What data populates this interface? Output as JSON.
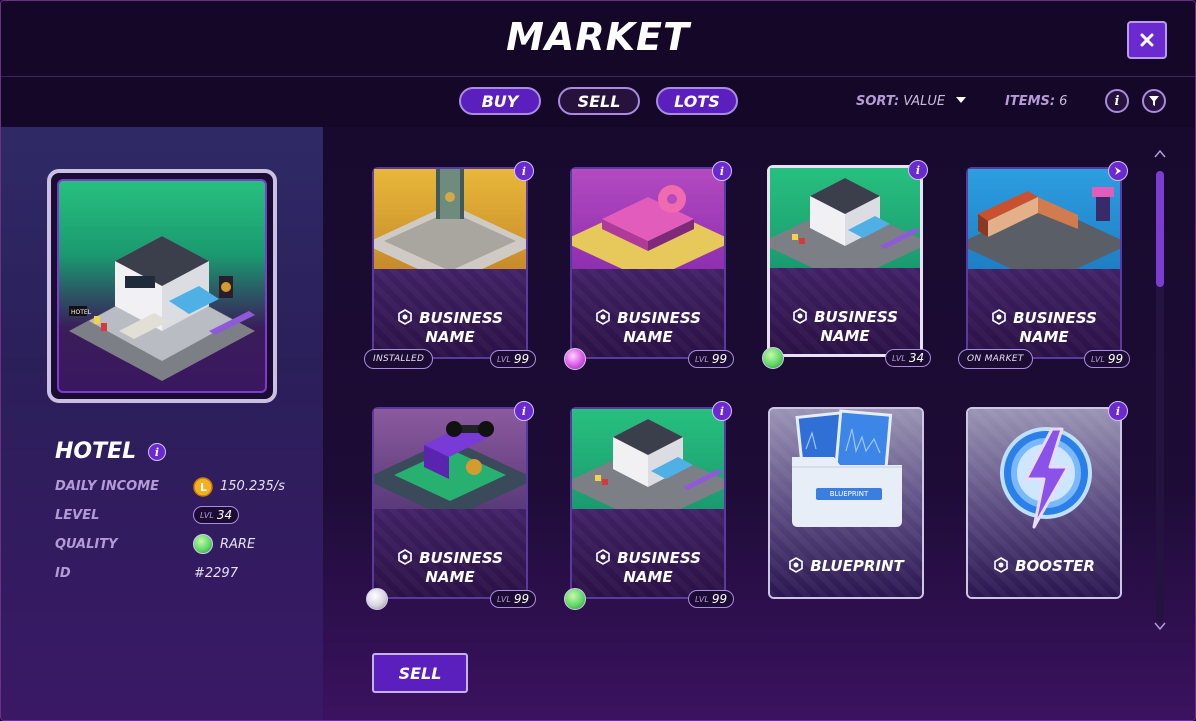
{
  "window": {
    "title": "MARKET"
  },
  "tabs": {
    "buy": "BUY",
    "sell": "SELL",
    "lots": "LOTS"
  },
  "sort": {
    "label": "SORT:",
    "value": "VALUE"
  },
  "items": {
    "label": "ITEMS:",
    "count": "6"
  },
  "info_glyph": "i",
  "selected": {
    "name": "HOTEL",
    "daily_income_label": "DAILY INCOME",
    "daily_income_value": "150.235/s",
    "level_label": "LEVEL",
    "level_prefix": "LVL",
    "level_value": "34",
    "quality_label": "QUALITY",
    "quality_value": "RARE",
    "id_label": "ID",
    "id_value": "#2297"
  },
  "cards": [
    {
      "title1": "BUSINESS",
      "title2": "NAME",
      "badge": "INSTALLED",
      "lvl_prefix": "LVL",
      "lvl": "99",
      "image": "skyscraper-construction"
    },
    {
      "title1": "BUSINESS",
      "title2": "NAME",
      "badge": "EPIC",
      "lvl_prefix": "LVL",
      "lvl": "99",
      "image": "donuts-shop"
    },
    {
      "title1": "BUSINESS",
      "title2": "NAME",
      "badge": "RARE",
      "lvl_prefix": "LVL",
      "lvl": "34",
      "image": "hotel"
    },
    {
      "title1": "BUSINESS",
      "title2": "NAME",
      "badge": "ON MARKET",
      "lvl_prefix": "LVL",
      "lvl": "99",
      "image": "motel"
    },
    {
      "title1": "BUSINESS",
      "title2": "NAME",
      "badge": "COMMON",
      "lvl_prefix": "LVL",
      "lvl": "99",
      "image": "gym"
    },
    {
      "title1": "BUSINESS",
      "title2": "NAME",
      "badge": "RARE",
      "lvl_prefix": "LVL",
      "lvl": "99",
      "image": "hotel"
    },
    {
      "title": "BLUEPRINT",
      "folder_label": "BLUEPRINT",
      "image": "blueprint-folder"
    },
    {
      "title": "BOOSTER",
      "image": "lightning-booster"
    }
  ],
  "sell_button": "SELL",
  "colors": {
    "accent": "#6a2ad0",
    "epic": "#d858e8",
    "rare": "#5fd86a",
    "common": "#d8d4e0",
    "coin": "#f5b021"
  }
}
